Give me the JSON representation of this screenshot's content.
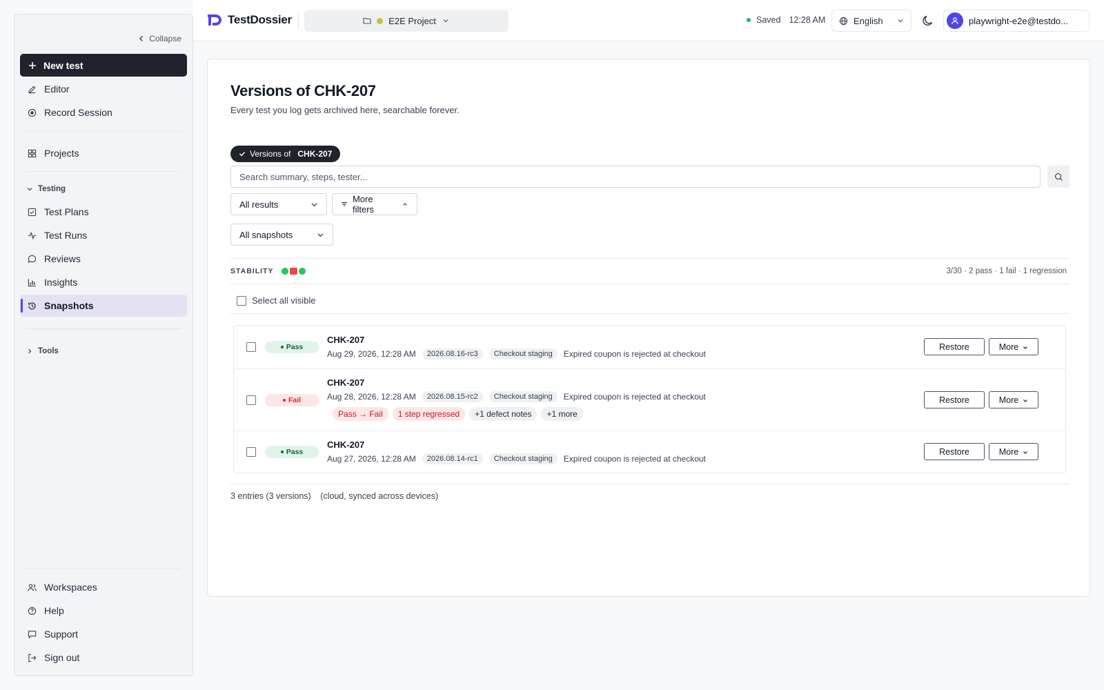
{
  "sidebar": {
    "collapse_label": "Collapse",
    "new_test_label": "New test",
    "top_items": [
      {
        "label": "Editor",
        "icon": "pencil-icon"
      },
      {
        "label": "Record Session",
        "icon": "record-icon"
      }
    ],
    "projects_label": "Projects",
    "testing_section_label": "Testing",
    "testing_items": [
      {
        "label": "Test Plans",
        "icon": "checklist-icon"
      },
      {
        "label": "Test Runs",
        "icon": "activity-icon"
      },
      {
        "label": "Reviews",
        "icon": "chat-bubble-icon"
      },
      {
        "label": "Insights",
        "icon": "bar-chart-icon"
      },
      {
        "label": "Snapshots",
        "icon": "history-icon",
        "active": true
      }
    ],
    "tools_section_label": "Tools",
    "bottom_items": [
      {
        "label": "Workspaces",
        "icon": "users-icon"
      },
      {
        "label": "Help",
        "icon": "help-icon"
      },
      {
        "label": "Support",
        "icon": "message-square-icon"
      },
      {
        "label": "Sign out",
        "icon": "sign-out-icon"
      }
    ]
  },
  "topbar": {
    "app_name": "TestDossier",
    "project_name": "E2E Project",
    "project_color": "#c8c23a",
    "save_status": "Saved",
    "save_time": "12:28 AM",
    "language": "English",
    "user_email": "playwright-e2e@testdo..."
  },
  "main": {
    "title": "Versions of CHK-207",
    "subtitle": "Every test you log gets archived here, searchable forever.",
    "filter_chip": {
      "prefix": "Versions of",
      "value": "CHK-207"
    },
    "search_placeholder": "Search summary, steps, tester...",
    "results_filter": "All results",
    "more_filters_label": "More filters",
    "snapshots_filter": "All snapshots",
    "stability": {
      "label": "STABILITY",
      "marks": [
        "pass",
        "fail",
        "pass"
      ],
      "summary": "3/30 · 2 pass · 1 fail · 1 regression"
    },
    "select_all_label": "Select all visible",
    "rows": [
      {
        "status": "Pass",
        "title": "CHK-207",
        "date": "Aug 29, 2026, 12:28 AM",
        "version": "2026.08.16-rc3",
        "environment": "Checkout staging",
        "summary": "Expired coupon is rejected at checkout"
      },
      {
        "status": "Fail",
        "title": "CHK-207",
        "date": "Aug 28, 2026, 12:28 AM",
        "version": "2026.08.15-rc2",
        "environment": "Checkout staging",
        "summary": "Expired coupon is rejected at checkout",
        "pills": [
          "Pass → Fail",
          "1 step regressed",
          "+1 defect notes",
          "+1 more"
        ]
      },
      {
        "status": "Pass",
        "title": "CHK-207",
        "date": "Aug 27, 2026, 12:28 AM",
        "version": "2026.08.14-rc1",
        "environment": "Checkout staging",
        "summary": "Expired coupon is rejected at checkout"
      }
    ],
    "restore_label": "Restore",
    "more_label": "More",
    "footer_count": "3 entries (3 versions)",
    "footer_sync": "(cloud, synced across devices)"
  },
  "colors": {
    "accent": "#4f46e5",
    "pass": "#22c55e",
    "fail": "#ef4444",
    "dark": "#1f232b"
  }
}
